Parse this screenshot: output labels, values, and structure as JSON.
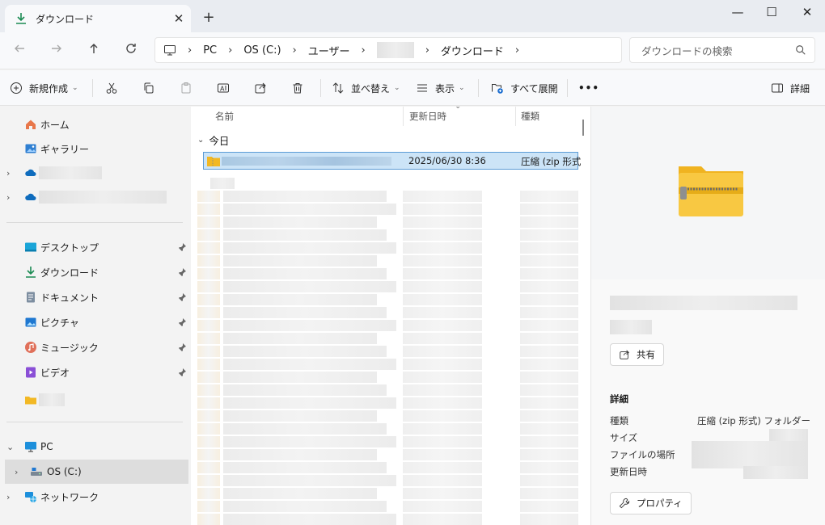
{
  "window": {
    "tab_title": "ダウンロード",
    "tab_close": "✕",
    "new_tab": "+",
    "minimize": "—",
    "maximize": "☐",
    "close": "✕"
  },
  "address": {
    "breadcrumbs": [
      "PC",
      "OS (C:)",
      "ユーザー",
      "",
      "ダウンロード"
    ],
    "search_placeholder": "ダウンロードの検索"
  },
  "toolbar": {
    "new_label": "新規作成",
    "sort_label": "並べ替え",
    "view_label": "表示",
    "expand_all_label": "すべて展開",
    "more_label": "•••",
    "details_label": "詳細"
  },
  "navpane": {
    "home": "ホーム",
    "gallery": "ギャラリー",
    "quick_access": [
      "デスクトップ",
      "ダウンロード",
      "ドキュメント",
      "ピクチャ",
      "ミュージック",
      "ビデオ"
    ],
    "pc": "PC",
    "os_drive": "OS (C:)",
    "network": "ネットワーク"
  },
  "filelist": {
    "columns": [
      "名前",
      "更新日時",
      "種類"
    ],
    "group_label": "今日",
    "selected_file": {
      "date": "2025/06/30 8:36",
      "type": "圧縮 (zip 形式"
    }
  },
  "details": {
    "share_label": "共有",
    "section_title": "詳細",
    "rows": [
      {
        "label": "種類",
        "value": "圧縮 (zip 形式) フォルダー"
      },
      {
        "label": "サイズ",
        "value": ""
      },
      {
        "label": "ファイルの場所",
        "value": ""
      },
      {
        "label": "更新日時",
        "value": ""
      }
    ],
    "properties_label": "プロパティ"
  },
  "colors": {
    "selection_bg": "#cce4f7",
    "selection_border": "#5b9bd5",
    "accent_green": "#1a8a52",
    "folder_yellow": "#f2b824"
  }
}
